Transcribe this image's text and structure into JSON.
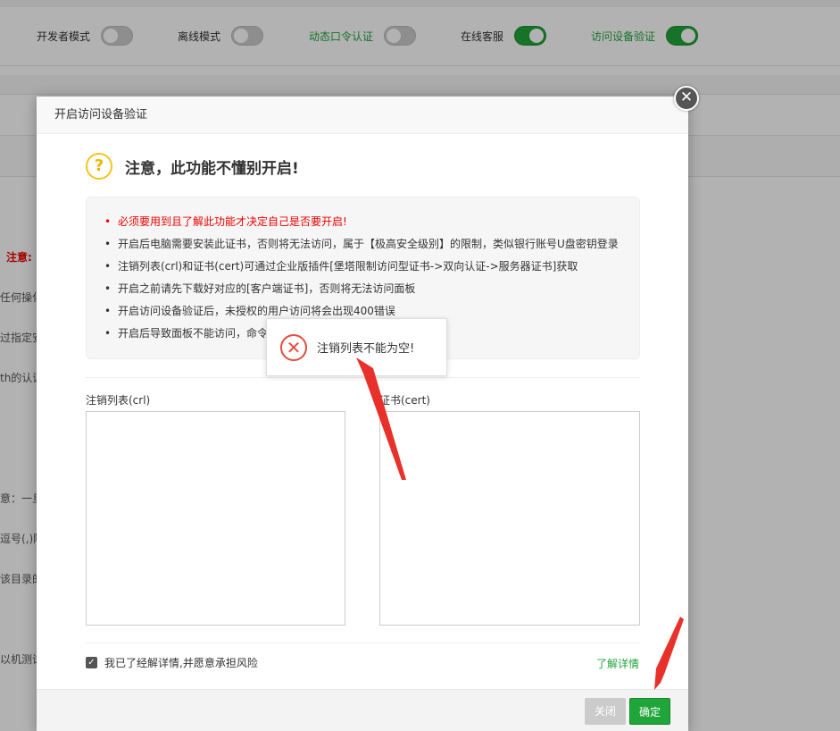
{
  "settings": [
    {
      "label": "开发者模式",
      "on": false,
      "green": false
    },
    {
      "label": "离线模式",
      "on": false,
      "green": false
    },
    {
      "label": "动态口令认证",
      "on": false,
      "green": true
    },
    {
      "label": "在线客服",
      "on": true,
      "green": false
    },
    {
      "label": "访问设备验证",
      "on": true,
      "green": true
    }
  ],
  "background_fragments": {
    "note": "注意:",
    "f1": "任何操化",
    "f2": "过指定安",
    "f3": "th的认证",
    "f4": "意：一旦",
    "f5": "逗号(,)隔",
    "f6": "该目录的",
    "f7": "以机测试"
  },
  "modal": {
    "title": "开启访问设备验证",
    "close_symbol": "✕",
    "warning_icon": "?",
    "warning_title": "注意，此功能不懂别开启!",
    "notices": [
      "必须要用到且了解此功能才决定自己是否要开启!",
      "开启后电脑需要安装此证书，否则将无法访问，属于【极高安全级别】的限制，类似银行账号U盘密钥登录",
      "注销列表(crl)和证书(cert)可通过企业版插件[堡塔限制访问型证书->双向认证->服务器证书]获取",
      "开启之前请先下载好对应的[客户端证书]，否则将无法访问面板",
      "开启访问设备验证后，未授权的用户访问将会出现400错误",
      "开启后导致面板不能访问，命令"
    ],
    "crl_label": "注销列表(crl)",
    "cert_label": "证书(cert)",
    "crl_value": "",
    "cert_value": "",
    "agree_text": "我已了经解详情,并愿意承担风险",
    "agree_checked": true,
    "learn_more": "了解详情",
    "btn_close": "关闭",
    "btn_ok": "确定"
  },
  "toast": {
    "icon": "✕",
    "message": "注销列表不能为空!"
  },
  "colors": {
    "accent_green": "#20a53a",
    "warning_red": "#e00000",
    "annotation_red": "#e8312a"
  }
}
